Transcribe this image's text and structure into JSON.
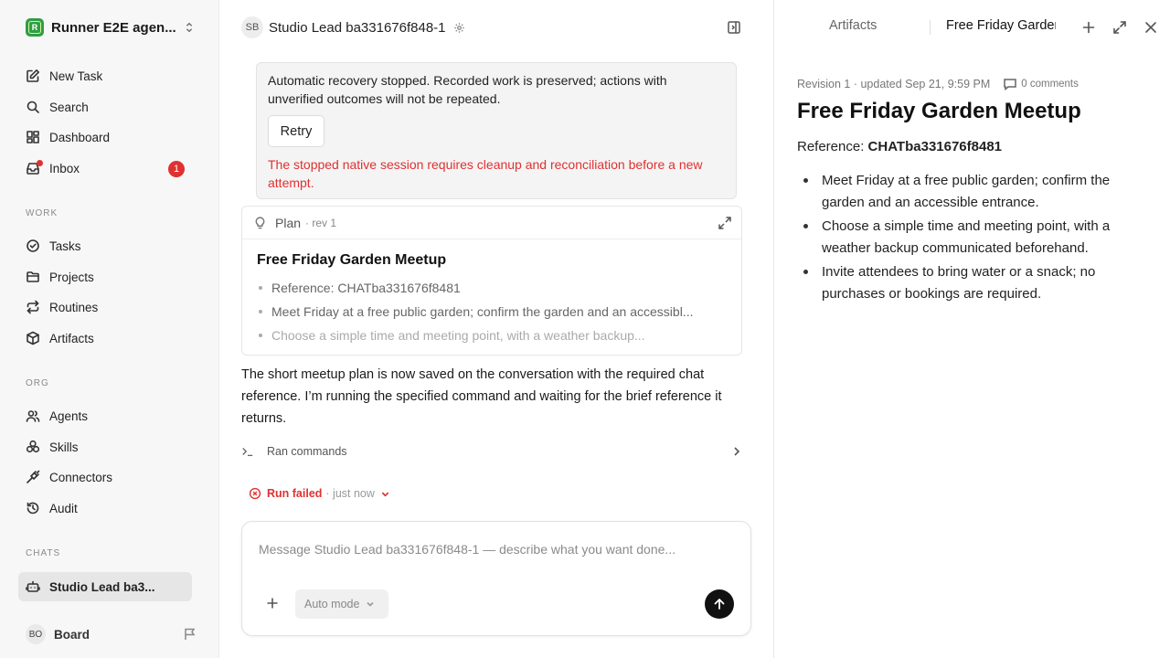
{
  "workspace": {
    "name": "Runner E2E agen...",
    "logo_letter": "R"
  },
  "nav": {
    "main": [
      {
        "label": "New Task",
        "icon": "edit-icon"
      },
      {
        "label": "Search",
        "icon": "search-icon"
      },
      {
        "label": "Dashboard",
        "icon": "grid-icon"
      },
      {
        "label": "Inbox",
        "icon": "inbox-icon",
        "badge": "1"
      }
    ],
    "work_header": "WORK",
    "work": [
      {
        "label": "Tasks",
        "icon": "check-circle-icon"
      },
      {
        "label": "Projects",
        "icon": "folder-icon"
      },
      {
        "label": "Routines",
        "icon": "repeat-icon"
      },
      {
        "label": "Artifacts",
        "icon": "box-icon"
      }
    ],
    "org_header": "ORG",
    "org": [
      {
        "label": "Agents",
        "icon": "users-icon"
      },
      {
        "label": "Skills",
        "icon": "skills-icon"
      },
      {
        "label": "Connectors",
        "icon": "plug-icon"
      },
      {
        "label": "Audit",
        "icon": "history-icon"
      }
    ],
    "chats_header": "CHATS",
    "chats": [
      {
        "label": "Studio Lead ba3...",
        "icon": "bot-icon"
      }
    ],
    "board": {
      "initials": "BO",
      "label": "Board"
    }
  },
  "chat": {
    "avatar": "SB",
    "title": "Studio Lead ba331676f848-1",
    "error": {
      "text": "Automatic recovery stopped. Recorded work is preserved; actions with unverified outcomes will not be repeated.",
      "retry_label": "Retry",
      "red_text": "The stopped native session requires cleanup and reconciliation before a new attempt."
    },
    "plan": {
      "label": "Plan",
      "rev": "· rev 1",
      "title": "Free Friday Garden Meetup",
      "items": [
        "Reference: CHATba331676f8481",
        "Meet Friday at a free public garden; confirm the garden and an accessibl...",
        "Choose a simple time and meeting point, with a weather backup..."
      ]
    },
    "message": "The short meetup plan is now saved on the conversation with the required chat reference. I’m running the specified command and waiting for the brief reference it returns.",
    "commands_label": "Ran commands",
    "run_status": "Run failed",
    "run_time": "· just now",
    "composer": {
      "placeholder": "Message Studio Lead ba331676f848-1 — describe what you want done...",
      "mode": "Auto mode"
    }
  },
  "artifact": {
    "tabs": [
      "Artifacts",
      "Free Friday Garden Meetup"
    ],
    "meta": "Revision 1 · updated Sep 21, 9:59 PM",
    "comments": "0 comments",
    "title": "Free Friday Garden Meetup",
    "reference_label": "Reference:",
    "reference_value": "CHATba331676f8481",
    "items": [
      "Meet Friday at a free public garden; confirm the garden and an accessible entrance.",
      "Choose a simple time and meeting point, with a weather backup communicated beforehand.",
      "Invite attendees to bring water or a snack; no purchases or bookings are required."
    ]
  },
  "colors": {
    "accent_error": "#e03131",
    "logo_green": "#2f9e44",
    "send_button": "#111111"
  }
}
